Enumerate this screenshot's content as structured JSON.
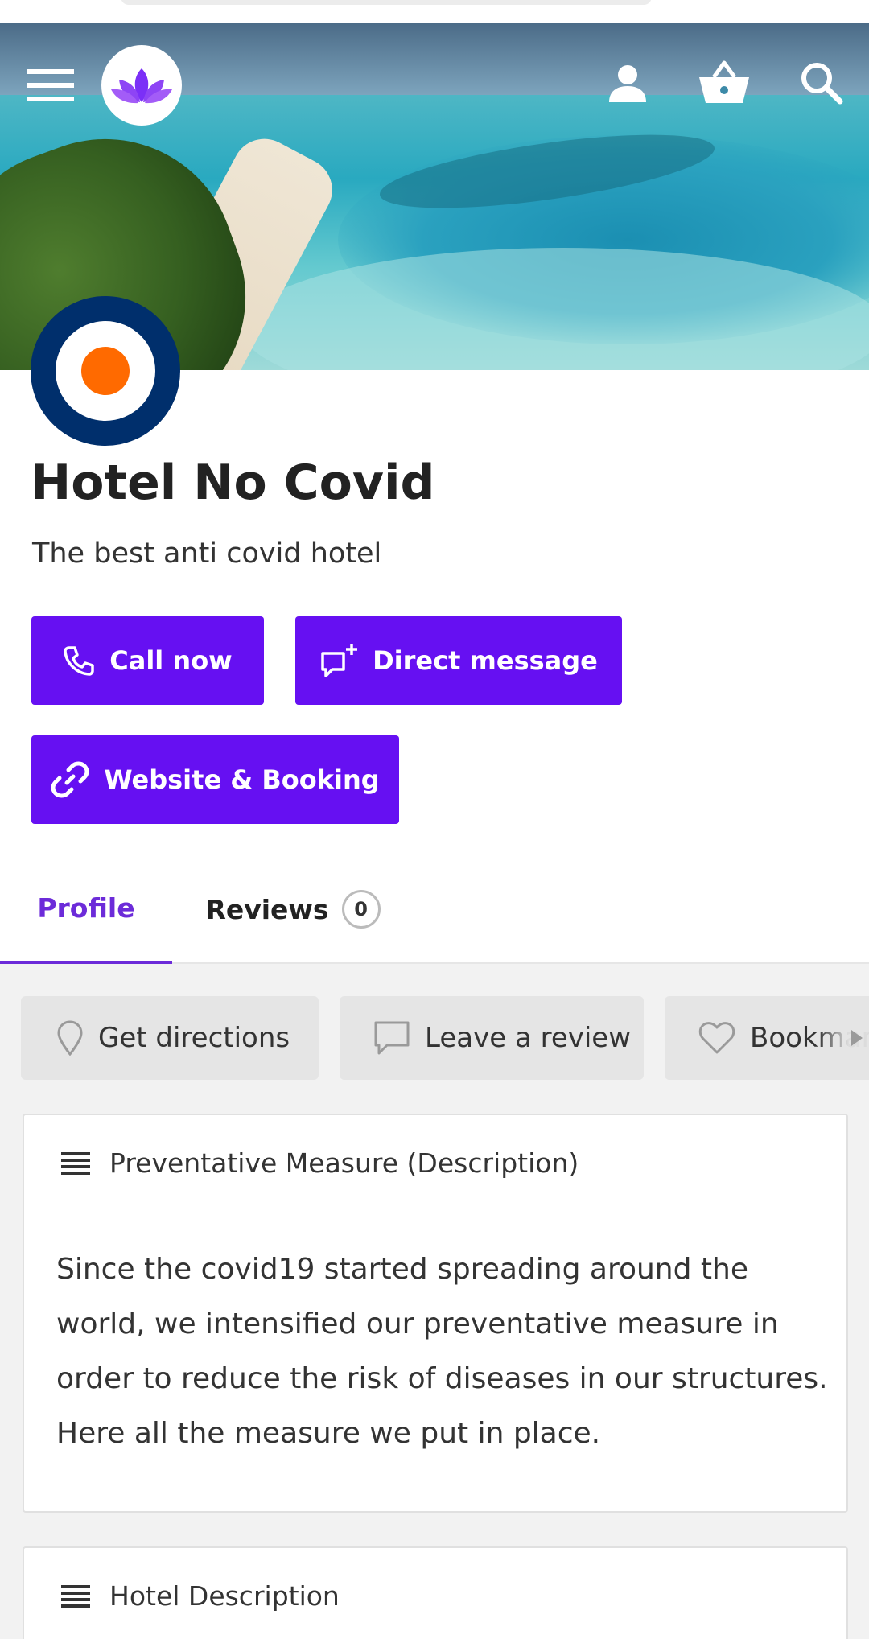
{
  "header": {
    "icons": {
      "menu": "menu-icon",
      "logo": "lotus-logo",
      "user": "user-icon",
      "basket": "basket-icon",
      "search": "search-icon"
    }
  },
  "listing": {
    "title": "Hotel No Covid",
    "tagline": "The best anti covid hotel"
  },
  "actions": {
    "call_label": "Call now",
    "message_label": "Direct message",
    "website_label": "Website & Booking"
  },
  "tabs": [
    {
      "label": "Profile",
      "active": true
    },
    {
      "label": "Reviews",
      "count": "0"
    }
  ],
  "quick_actions": [
    {
      "label": "Get directions",
      "icon": "map-pin-icon"
    },
    {
      "label": "Leave a review",
      "icon": "comment-icon"
    },
    {
      "label": "Bookmark",
      "icon": "heart-icon"
    }
  ],
  "sections": [
    {
      "heading": "Preventative Measure (Description)",
      "body": "Since the covid19 started spreading around the world, we intensified our preventative measure in order to reduce the risk of diseases in our structures. Here all the measure we put in place."
    },
    {
      "heading": "Hotel Description"
    }
  ],
  "colors": {
    "accent": "#6610f2",
    "tab_active": "#6c2bd9",
    "avatar_outer": "#002f6c",
    "avatar_dot": "#ff6a00",
    "logo_purple": "#7b2ff7"
  }
}
